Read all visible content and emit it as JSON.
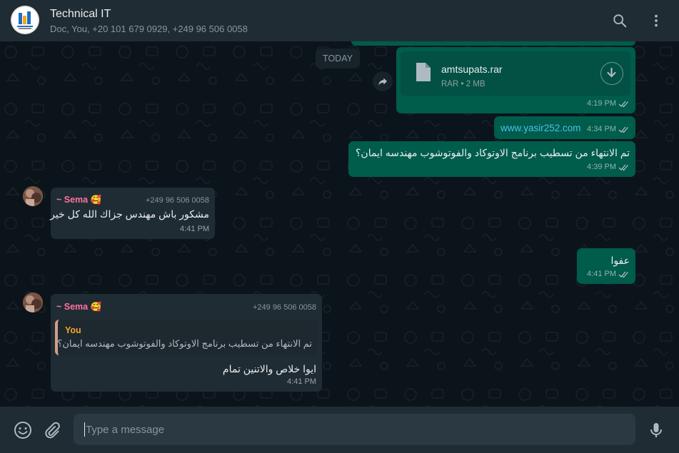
{
  "header": {
    "title": "Technical IT",
    "participants": "Doc, You, +20 101 679 0929, +249 96 506 0058",
    "avatar_icon": "group-logo-icon",
    "search_icon": "search-icon",
    "menu_icon": "kebab-menu-icon"
  },
  "chat": {
    "date_label": "TODAY",
    "messages": [
      {
        "type": "file",
        "file_name": "amtsupats.rar",
        "file_meta": "RAR • 2 MB",
        "time": "4:19 PM"
      },
      {
        "type": "link",
        "text": "www.yasir252.com",
        "time": "4:34 PM"
      },
      {
        "type": "text",
        "text": "تم الانتهاء من تسطيب برنامج الاوتوكاد والفوتوشوب مهندسه ايمان؟",
        "time": "4:39 PM"
      },
      {
        "type": "incoming",
        "sender": "~ Sema 🥰",
        "phone": "+249 96 506 0058",
        "text": "مشكور باش مهندس جزاك الله كل خير",
        "time": "4:41 PM"
      },
      {
        "type": "text",
        "text": "عفوا",
        "time": "4:41 PM"
      },
      {
        "type": "incoming-reply",
        "sender": "~ Sema 🥰",
        "phone": "+249 96 506 0058",
        "quote_author": "You",
        "quote_text": "تم الانتهاء من تسطيب برنامج الاوتوكاد والفوتوشوب مهندسه ايمان؟",
        "text": "ايوا خلاص والاتنين تمام",
        "time": "4:41 PM"
      }
    ]
  },
  "composer": {
    "placeholder": "Type a message",
    "emoji_icon": "emoji-icon",
    "attach_icon": "paperclip-icon",
    "mic_icon": "microphone-icon"
  },
  "colors": {
    "outgoing_bubble": "#005c4b",
    "incoming_bubble": "#202c33",
    "sender_name": "#ff72a1",
    "quote_author": "#f5a623",
    "link": "#53bdeb"
  }
}
